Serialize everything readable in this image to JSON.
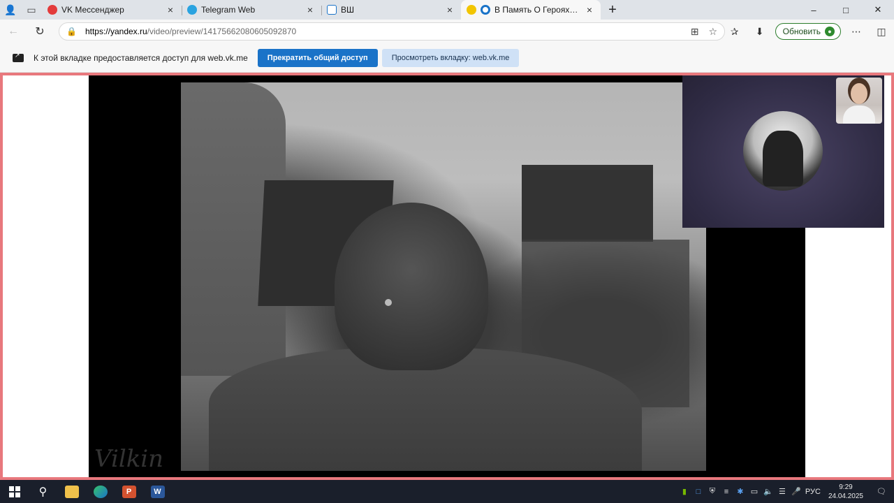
{
  "tabstrip": {
    "tabs": [
      {
        "title": "VK Мессенджер",
        "color": "#e33b3b",
        "active": false
      },
      {
        "title": "Telegram Web",
        "color": "#2aa3e0",
        "active": false
      },
      {
        "title": "ВШ",
        "color": "#1a73c8",
        "active": false
      },
      {
        "title": "В Память О Героях Великой",
        "color": "#1a73c8",
        "active": true
      }
    ]
  },
  "toolbar": {
    "url_host": "https://yandex.ru",
    "url_path": "/video/preview/14175662080605092870",
    "update_label": "Обновить"
  },
  "sharebar": {
    "message": "К этой вкладке предоставляется доступ для web.vk.me",
    "stop_label": "Прекратить общий доступ",
    "view_label": "Просмотреть вкладку: web.vk.me"
  },
  "video": {
    "watermark": "Vilkin"
  },
  "taskbar": {
    "language": "РУС",
    "time": "9:29",
    "date": "24.04.2025"
  },
  "colors": {
    "share_frame": "#e8787d",
    "stop_button": "#1a73c8",
    "update_border": "#2b7d2b"
  }
}
